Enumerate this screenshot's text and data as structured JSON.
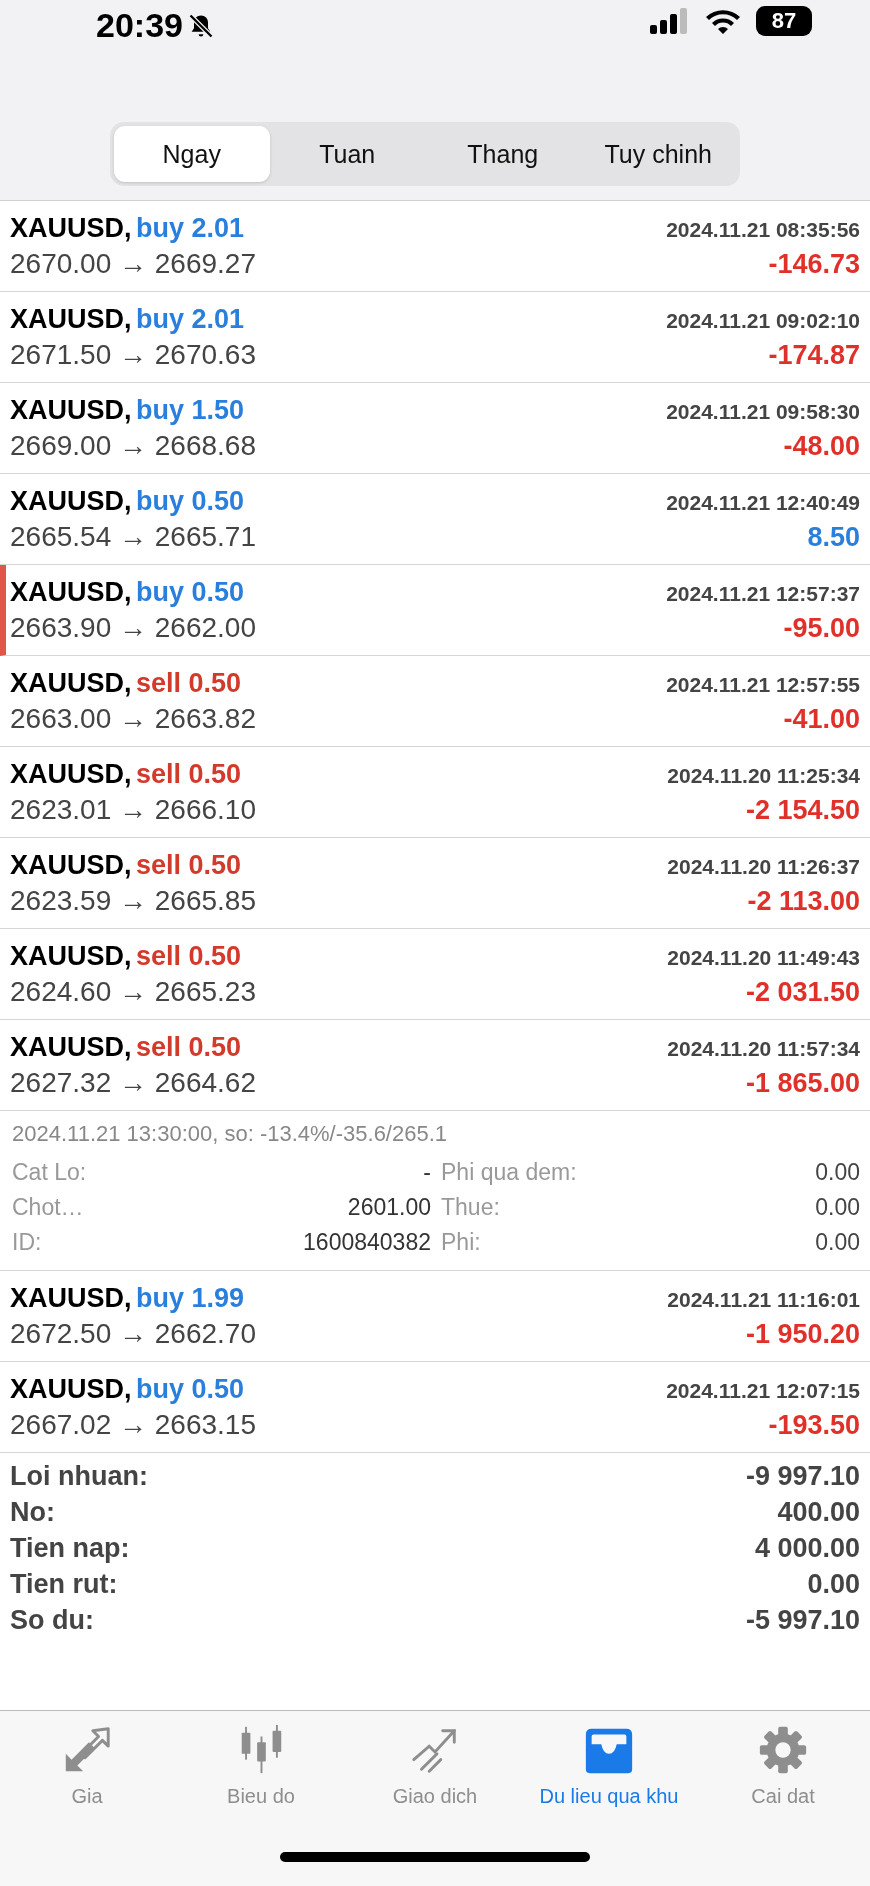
{
  "status_bar": {
    "time": "20:39",
    "battery": "87"
  },
  "tabs": [
    {
      "label": "Ngay",
      "selected": true
    },
    {
      "label": "Tuan",
      "selected": false
    },
    {
      "label": "Thang",
      "selected": false
    },
    {
      "label": "Tuy chinh",
      "selected": false
    }
  ],
  "deals": [
    {
      "symbol": "XAUUSD,",
      "volume": {
        "kind": "buy",
        "text": "buy 2.01"
      },
      "time": "2024.11.21 08:35:56",
      "prices": "2670.00 → 2669.27",
      "profit": {
        "kind": "loss",
        "text": "-146.73"
      },
      "marked": false
    },
    {
      "symbol": "XAUUSD,",
      "volume": {
        "kind": "buy",
        "text": "buy 2.01"
      },
      "time": "2024.11.21 09:02:10",
      "prices": "2671.50 → 2670.63",
      "profit": {
        "kind": "loss",
        "text": "-174.87"
      },
      "marked": false
    },
    {
      "symbol": "XAUUSD,",
      "volume": {
        "kind": "buy",
        "text": "buy 1.50"
      },
      "time": "2024.11.21 09:58:30",
      "prices": "2669.00 → 2668.68",
      "profit": {
        "kind": "loss",
        "text": "-48.00"
      },
      "marked": false
    },
    {
      "symbol": "XAUUSD,",
      "volume": {
        "kind": "buy",
        "text": "buy 0.50"
      },
      "time": "2024.11.21 12:40:49",
      "prices": "2665.54 → 2665.71",
      "profit": {
        "kind": "gain",
        "text": "8.50"
      },
      "marked": false
    },
    {
      "symbol": "XAUUSD,",
      "volume": {
        "kind": "buy",
        "text": "buy 0.50"
      },
      "time": "2024.11.21 12:57:37",
      "prices": "2663.90 → 2662.00",
      "profit": {
        "kind": "loss",
        "text": "-95.00"
      },
      "marked": true
    },
    {
      "symbol": "XAUUSD,",
      "volume": {
        "kind": "sell",
        "text": "sell 0.50"
      },
      "time": "2024.11.21 12:57:55",
      "prices": "2663.00 → 2663.82",
      "profit": {
        "kind": "loss",
        "text": "-41.00"
      },
      "marked": false
    },
    {
      "symbol": "XAUUSD,",
      "volume": {
        "kind": "sell",
        "text": "sell 0.50"
      },
      "time": "2024.11.20 11:25:34",
      "prices": "2623.01 → 2666.10",
      "profit": {
        "kind": "loss",
        "text": "-2 154.50"
      },
      "marked": false
    },
    {
      "symbol": "XAUUSD,",
      "volume": {
        "kind": "sell",
        "text": "sell 0.50"
      },
      "time": "2024.11.20 11:26:37",
      "prices": "2623.59 → 2665.85",
      "profit": {
        "kind": "loss",
        "text": "-2 113.00"
      },
      "marked": false
    },
    {
      "symbol": "XAUUSD,",
      "volume": {
        "kind": "sell",
        "text": "sell 0.50"
      },
      "time": "2024.11.20 11:49:43",
      "prices": "2624.60 → 2665.23",
      "profit": {
        "kind": "loss",
        "text": "-2 031.50"
      },
      "marked": false
    },
    {
      "symbol": "XAUUSD,",
      "volume": {
        "kind": "sell",
        "text": "sell 0.50"
      },
      "time": "2024.11.20 11:57:34",
      "prices": "2627.32 → 2664.62",
      "profit": {
        "kind": "loss",
        "text": "-1 865.00"
      },
      "marked": false,
      "details": {
        "summary": "2024.11.21 13:30:00, so: -13.4%/-35.6/265.1",
        "columns": [
          [
            {
              "label": "Cat Lo:",
              "value": "-"
            },
            {
              "label": "Chot…",
              "value": "2601.00"
            },
            {
              "label": "ID:",
              "value": "1600840382"
            }
          ],
          [
            {
              "label": "Phi qua dem:",
              "value": "0.00"
            },
            {
              "label": "Thue:",
              "value": "0.00"
            },
            {
              "label": "Phi:",
              "value": "0.00"
            }
          ]
        ]
      }
    },
    {
      "symbol": "XAUUSD,",
      "volume": {
        "kind": "buy",
        "text": "buy 1.99"
      },
      "time": "2024.11.21 11:16:01",
      "prices": "2672.50 → 2662.70",
      "profit": {
        "kind": "loss",
        "text": "-1 950.20"
      },
      "marked": false
    },
    {
      "symbol": "XAUUSD,",
      "volume": {
        "kind": "buy",
        "text": "buy 0.50"
      },
      "time": "2024.11.21 12:07:15",
      "prices": "2667.02 → 2663.15",
      "profit": {
        "kind": "loss",
        "text": "-193.50"
      },
      "marked": false
    }
  ],
  "totals": [
    {
      "label": "Loi nhuan:",
      "value": "-9 997.10"
    },
    {
      "label": "No:",
      "value": "400.00"
    },
    {
      "label": "Tien nap:",
      "value": "4 000.00"
    },
    {
      "label": "Tien rut:",
      "value": "0.00"
    },
    {
      "label": "So du:",
      "value": "-5 997.10"
    }
  ],
  "nav": [
    {
      "label": "Gia",
      "selected": false
    },
    {
      "label": "Bieu do",
      "selected": false
    },
    {
      "label": "Giao dich",
      "selected": false
    },
    {
      "label": "Du lieu qua khu",
      "selected": true
    },
    {
      "label": "Cai dat",
      "selected": false
    }
  ]
}
